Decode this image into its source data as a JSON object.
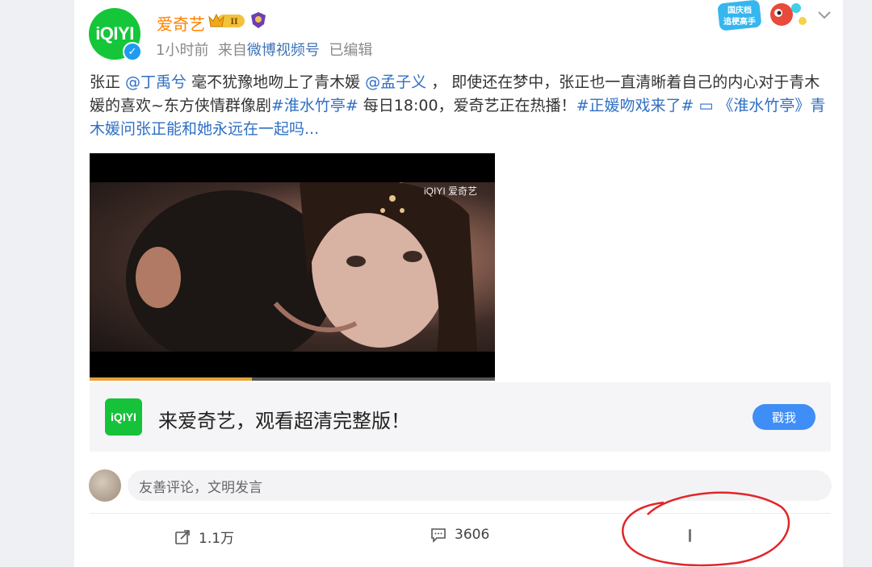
{
  "post": {
    "author": "爱奇艺",
    "avatar_text": "iQIYI",
    "badge_level": "II",
    "time": "1小时前",
    "source_prefix": "来自",
    "source": "微博视频号",
    "edited": "已编辑",
    "text_segments": [
      {
        "text": "张正 ",
        "type": "text"
      },
      {
        "text": "@丁禹兮",
        "type": "link"
      },
      {
        "text": " 毫不犹豫地吻上了青木媛 ",
        "type": "text"
      },
      {
        "text": "@孟子义",
        "type": "link"
      },
      {
        "text": " ， 即使还在梦中，张正也一直清晰着自己的内心对于青木媛的喜欢~东方侠情群像剧",
        "type": "text"
      },
      {
        "text": "#淮水竹亭#",
        "type": "link"
      },
      {
        "text": " 每日18:00，爱奇艺正在热播！",
        "type": "text"
      },
      {
        "text": "#正媛吻戏来了#",
        "type": "link"
      },
      {
        "text": " ▭ 《淮水竹亭》青木媛问张正能和她永远在一起吗...",
        "type": "link"
      }
    ],
    "video_watermark": "iQIYI 爱奇艺",
    "video_progress": 0.4
  },
  "promo_badge": {
    "line1": "国庆档",
    "line2": "追梗高手"
  },
  "ad": {
    "logo_text": "iQIYI",
    "text": "来爱奇艺，观看超清完整版！",
    "button": "戳我"
  },
  "comment": {
    "placeholder": "友善评论，文明发言"
  },
  "actions": {
    "share_count": "1.1万",
    "comment_count": "3606"
  },
  "colors": {
    "brand_green": "#15c63a",
    "link_blue": "#2f6fc4",
    "username_orange": "#ff8200",
    "button_blue": "#3f8ef7",
    "annotation_red": "#e0262a"
  }
}
